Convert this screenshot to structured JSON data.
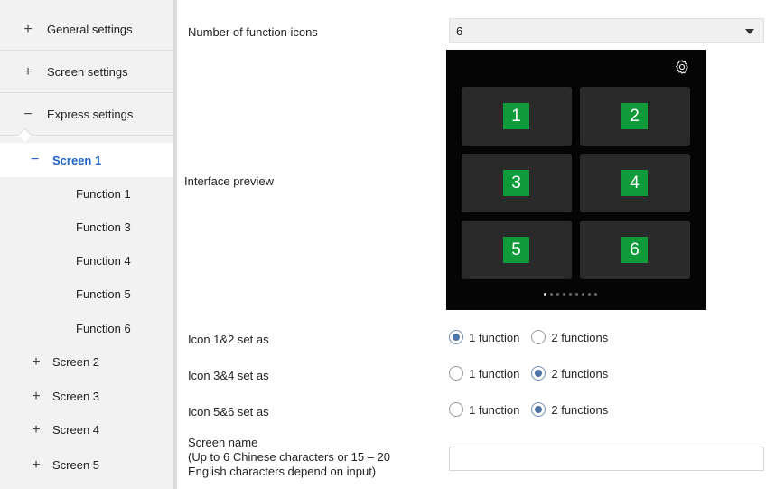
{
  "sidebar": {
    "top_items": [
      {
        "sign": "+",
        "label": "General settings"
      },
      {
        "sign": "+",
        "label": "Screen settings"
      },
      {
        "sign": "−",
        "label": "Express settings"
      }
    ],
    "active": {
      "sign": "−",
      "label": "Screen 1"
    },
    "functions": [
      "Function 1",
      "Function 3",
      "Function 4",
      "Function 5",
      "Function 6"
    ],
    "screens": [
      {
        "sign": "+",
        "label": "Screen 2"
      },
      {
        "sign": "+",
        "label": "Screen 3"
      },
      {
        "sign": "+",
        "label": "Screen 4"
      },
      {
        "sign": "+",
        "label": "Screen 5"
      }
    ]
  },
  "main": {
    "num_icons_label": "Number of function icons",
    "num_icons_value": "6",
    "preview_label": "Interface preview",
    "preview": {
      "tiles": [
        "1",
        "2",
        "3",
        "4",
        "5",
        "6"
      ],
      "page_dots": 9,
      "active_dot": 0,
      "icon": "gear-icon"
    },
    "icon_rows": [
      {
        "label": "Icon 1&2 set as",
        "options": [
          "1 function",
          "2 functions"
        ],
        "selected": "1 function"
      },
      {
        "label": "Icon 3&4 set as",
        "options": [
          "1 function",
          "2 functions"
        ],
        "selected": "2 functions"
      },
      {
        "label": "Icon 5&6 set as",
        "options": [
          "1 function",
          "2 functions"
        ],
        "selected": "2 functions"
      }
    ],
    "screen_name": {
      "label_line1": "Screen name",
      "label_line2": "(Up to 6 Chinese characters or 15 – 20",
      "label_line3": "English characters depend on input)",
      "value": ""
    }
  },
  "colors": {
    "accent": "#1b64c8",
    "tile_green": "#0f9b3a",
    "preview_bg": "#050505"
  }
}
